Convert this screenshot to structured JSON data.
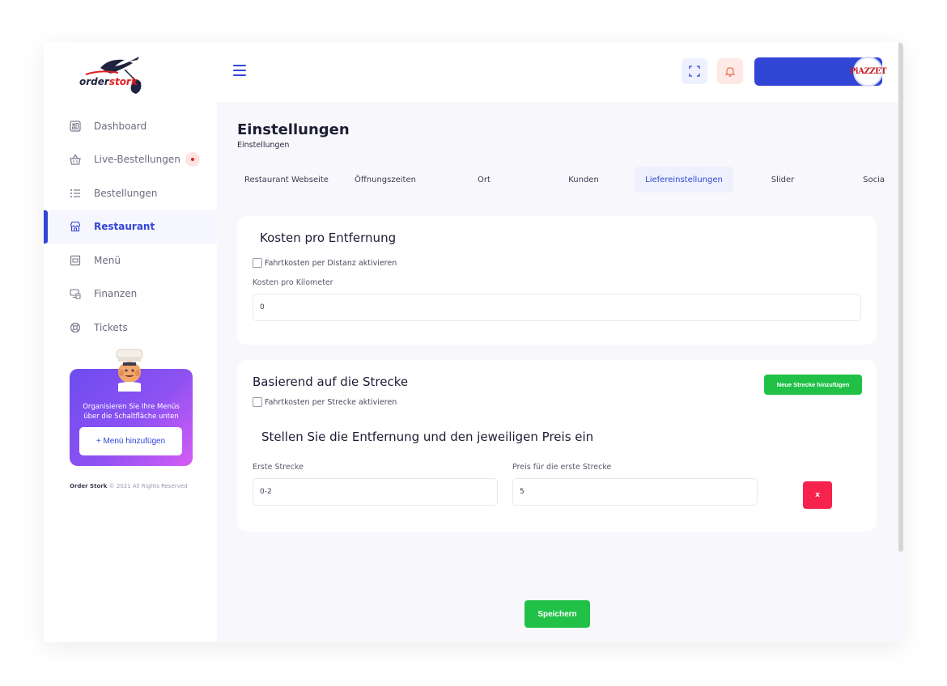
{
  "brand": {
    "logo_word_part1": "order",
    "logo_word_part2": "stork",
    "accent": "#3145d6"
  },
  "sidebar": {
    "items": [
      {
        "label": "Dashboard",
        "icon": "dashboard-icon"
      },
      {
        "label": "Live-Bestellungen",
        "icon": "basket-icon"
      },
      {
        "label": "Bestellungen",
        "icon": "list-icon"
      },
      {
        "label": "Restaurant",
        "icon": "store-icon"
      },
      {
        "label": "Menü",
        "icon": "menu-book-icon"
      },
      {
        "label": "Finanzen",
        "icon": "finance-icon"
      },
      {
        "label": "Tickets",
        "icon": "lifebuoy-icon"
      }
    ],
    "active_index": 3,
    "promo": {
      "text": "Organisieren Sie Ihre Menüs über die Schaltfläche unten",
      "button": "+ Menü hinzufügen"
    },
    "copyright_brand": "Order Stork",
    "copyright_text": "© 2021 All Rights Reserved"
  },
  "topbar": {
    "avatar_text": "PiAZZET",
    "fullscreen_icon": "fullscreen-icon",
    "bell_icon": "bell-icon"
  },
  "page": {
    "title": "Einstellungen",
    "breadcrumb": "Einstellungen"
  },
  "tabs": [
    {
      "label": "Restaurant Webseite"
    },
    {
      "label": "Öffnungszeiten"
    },
    {
      "label": "Ort"
    },
    {
      "label": "Kunden"
    },
    {
      "label": "Liefereinstellungen"
    },
    {
      "label": "Slider"
    },
    {
      "label": "Socia"
    }
  ],
  "active_tab": 4,
  "distance_cost": {
    "title": "Kosten pro Entfernung",
    "checkbox_label": "Fahrtkosten per Distanz aktivieren",
    "field_label": "Kosten pro Kilometer",
    "field_value": "0"
  },
  "route": {
    "title": "Basierend auf die Strecke",
    "add_button": "Neue Strecke hinzufügen",
    "checkbox_label": "Fahrtkosten per Strecke aktivieren",
    "subtitle": "Stellen Sie die Entfernung und den jeweiligen Preis ein",
    "range_label": "Erste Strecke",
    "range_value": "0-2",
    "price_label": "Preis für die erste Strecke",
    "price_value": "5",
    "remove_button": "x"
  },
  "save_button": "Speichern"
}
